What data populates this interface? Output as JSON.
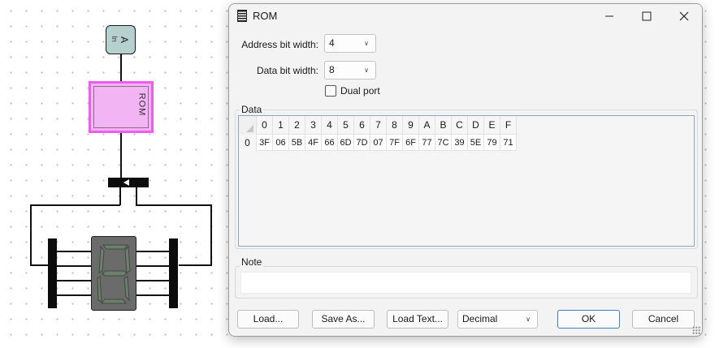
{
  "dialog": {
    "title": "ROM",
    "window_icon": "memory-chip-icon",
    "controls": {
      "minimize": "–",
      "maximize": "☐",
      "close": "✕"
    }
  },
  "fields": {
    "address_bit_width": {
      "label": "Address bit width:",
      "value": "4"
    },
    "data_bit_width": {
      "label": "Data bit width:",
      "value": "8"
    },
    "dual_port": {
      "label": "Dual port",
      "checked": false
    }
  },
  "data_group": {
    "title": "Data",
    "columns": [
      "0",
      "1",
      "2",
      "3",
      "4",
      "5",
      "6",
      "7",
      "8",
      "9",
      "A",
      "B",
      "C",
      "D",
      "E",
      "F"
    ],
    "rows": [
      {
        "label": "0",
        "cells": [
          "3F",
          "06",
          "5B",
          "4F",
          "66",
          "6D",
          "7D",
          "07",
          "7F",
          "6F",
          "77",
          "7C",
          "39",
          "5E",
          "79",
          "71"
        ]
      }
    ]
  },
  "note_group": {
    "title": "Note",
    "text": ""
  },
  "buttons": {
    "load": "Load...",
    "save_as": "Save As...",
    "load_text": "Load Text...",
    "format": "Decimal",
    "ok": "OK",
    "cancel": "Cancel"
  },
  "circuit": {
    "input_label": "A",
    "input_glyph": "In",
    "rom_label": "ROM"
  },
  "colors": {
    "rom_fill": "#f2b4f2",
    "rom_border": "#ef5cef",
    "input_fill": "#b6cfcf",
    "ok_border": "#3c7fc8",
    "segment_off": "#6e7e6e"
  }
}
